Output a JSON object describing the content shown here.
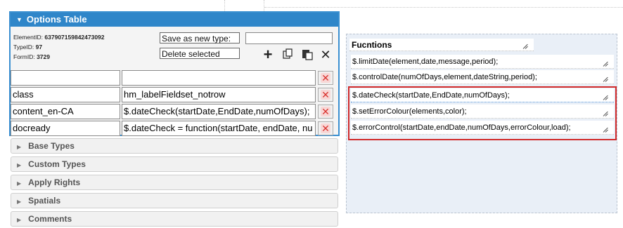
{
  "options": {
    "title": "Options Table",
    "element_id_label": "ElementID:",
    "element_id_value": "637907159842473092",
    "type_id_label": "TypeID:",
    "type_id_value": "97",
    "form_id_label": "FormID:",
    "form_id_value": "3729",
    "save_as_new_type_label": "Save as new type:",
    "delete_selected_label": "Delete selected",
    "rows": [
      {
        "key": "",
        "value": ""
      },
      {
        "key": "class",
        "value": "hm_labelFieldset_notrow"
      },
      {
        "key": "content_en-CA",
        "value": "$.dateCheck(startDate,EndDate,numOfDays);"
      },
      {
        "key": "docready",
        "value": "$.dateCheck = function(startDate, endDate, nu"
      }
    ]
  },
  "accordion": [
    "Base Types",
    "Custom Types",
    "Apply Rights",
    "Spatials",
    "Comments"
  ],
  "functions": {
    "title": "Fucntions",
    "items": [
      "$.limitDate(element,date,message,period);",
      "$.controlDate(numOfDays,element,dateString,period);",
      "$.dateCheck(startDate,EndDate,numOfDays);",
      "$.setErrorColour(elements,color);",
      "$.errorControl(startDate,endDate,numOfDays,errorColour,load);"
    ]
  },
  "colors": {
    "header_blue": "#2f86c9",
    "highlight_red": "#d12a2a",
    "delete_red": "#d9332f",
    "functions_bg": "#e9eff7"
  },
  "icons": [
    "plus-icon",
    "copy-icon",
    "paste-icon",
    "close-icon",
    "delete-x-icon",
    "resize-icon",
    "caret-down-icon",
    "chevron-right-icon"
  ]
}
